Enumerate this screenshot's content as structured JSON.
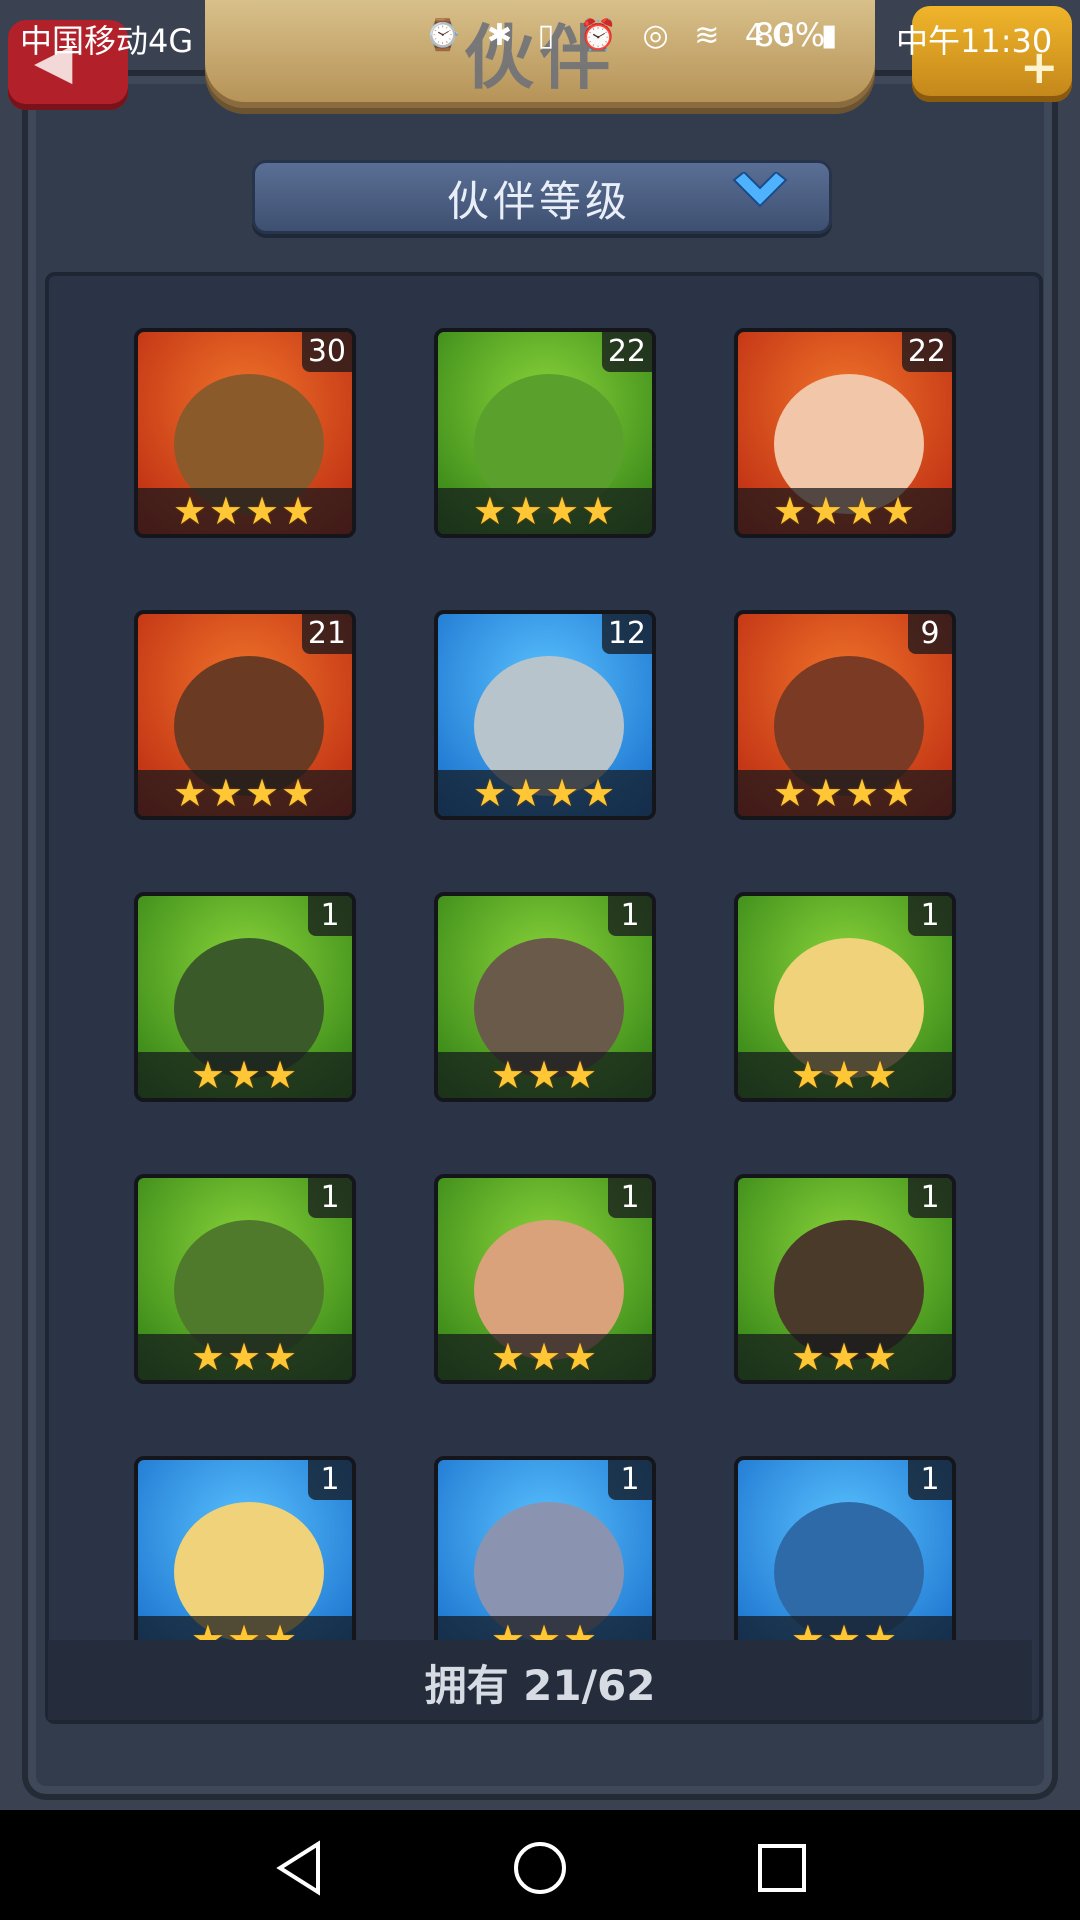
{
  "status_bar": {
    "carrier": "中国移动4G",
    "icons": "⌚ ✱ ▯ ⏰ ◎ ≋ 4G ▮",
    "battery": "80%",
    "time": "中午11:30"
  },
  "header": {
    "title": "伙伴",
    "back_icon": "◀",
    "add_icon": "+"
  },
  "sort_dropdown": {
    "label": "伙伴等级"
  },
  "companions": [
    {
      "level": "30",
      "stars": "★★★★",
      "theme": "orange",
      "face": "#8b5a2b"
    },
    {
      "level": "22",
      "stars": "★★★★",
      "theme": "green",
      "face": "#5aa02c"
    },
    {
      "level": "22",
      "stars": "★★★★",
      "theme": "orange",
      "face": "#f2c6a8"
    },
    {
      "level": "21",
      "stars": "★★★★",
      "theme": "orange",
      "face": "#6b3a22"
    },
    {
      "level": "12",
      "stars": "★★★★",
      "theme": "blue",
      "face": "#b7c4cc"
    },
    {
      "level": "9",
      "stars": "★★★★",
      "theme": "orange",
      "face": "#7a3a24"
    },
    {
      "level": "1",
      "stars": "★★★",
      "theme": "green",
      "face": "#3a5a2a"
    },
    {
      "level": "1",
      "stars": "★★★",
      "theme": "green",
      "face": "#6a5a4a"
    },
    {
      "level": "1",
      "stars": "★★★",
      "theme": "green",
      "face": "#efd27a"
    },
    {
      "level": "1",
      "stars": "★★★",
      "theme": "green",
      "face": "#4f7a2c"
    },
    {
      "level": "1",
      "stars": "★★★",
      "theme": "green",
      "face": "#d9a27a"
    },
    {
      "level": "1",
      "stars": "★★★",
      "theme": "green",
      "face": "#4a3a2a"
    },
    {
      "level": "1",
      "stars": "★★★",
      "theme": "blue",
      "face": "#efd27a"
    },
    {
      "level": "1",
      "stars": "★★★",
      "theme": "blue",
      "face": "#8a94b0"
    },
    {
      "level": "1",
      "stars": "★★★",
      "theme": "blue",
      "face": "#2f6aa8"
    }
  ],
  "owned": {
    "text": "拥有 21/62"
  },
  "colors": {
    "accent_gold": "#ffc635",
    "panel_bg": "#2b3446",
    "dropdown_bg": "#4a5d80"
  }
}
